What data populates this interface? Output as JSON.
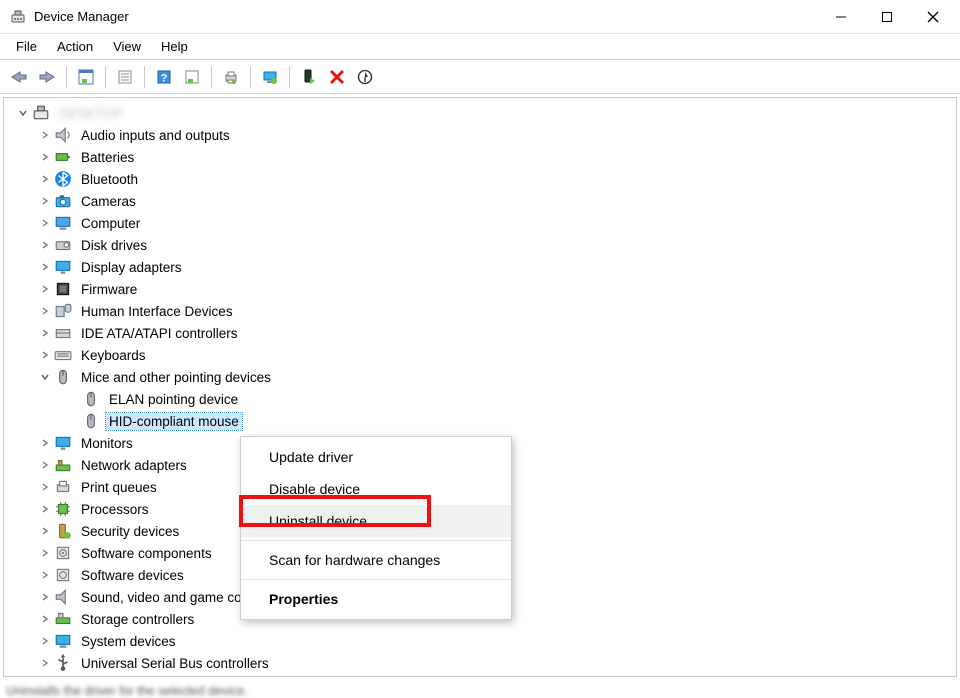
{
  "window": {
    "title": "Device Manager"
  },
  "menu": {
    "file": "File",
    "action": "Action",
    "view": "View",
    "help": "Help"
  },
  "tree": {
    "root": "DESKTOP",
    "categories": [
      {
        "label": "Audio inputs and outputs"
      },
      {
        "label": "Batteries"
      },
      {
        "label": "Bluetooth"
      },
      {
        "label": "Cameras"
      },
      {
        "label": "Computer"
      },
      {
        "label": "Disk drives"
      },
      {
        "label": "Display adapters"
      },
      {
        "label": "Firmware"
      },
      {
        "label": "Human Interface Devices"
      },
      {
        "label": "IDE ATA/ATAPI controllers"
      },
      {
        "label": "Keyboards"
      },
      {
        "label": "Mice and other pointing devices",
        "expanded": true,
        "children": [
          {
            "label": "ELAN pointing device"
          },
          {
            "label": "HID-compliant mouse",
            "selected": true
          }
        ]
      },
      {
        "label": "Monitors"
      },
      {
        "label": "Network adapters"
      },
      {
        "label": "Print queues"
      },
      {
        "label": "Processors"
      },
      {
        "label": "Security devices"
      },
      {
        "label": "Software components"
      },
      {
        "label": "Software devices"
      },
      {
        "label": "Sound, video and game controllers"
      },
      {
        "label": "Storage controllers"
      },
      {
        "label": "System devices"
      },
      {
        "label": "Universal Serial Bus controllers"
      }
    ]
  },
  "context_menu": {
    "update": "Update driver",
    "disable": "Disable device",
    "uninstall": "Uninstall device",
    "scan": "Scan for hardware changes",
    "properties": "Properties"
  },
  "status_text": "Uninstalls the driver for the selected device."
}
